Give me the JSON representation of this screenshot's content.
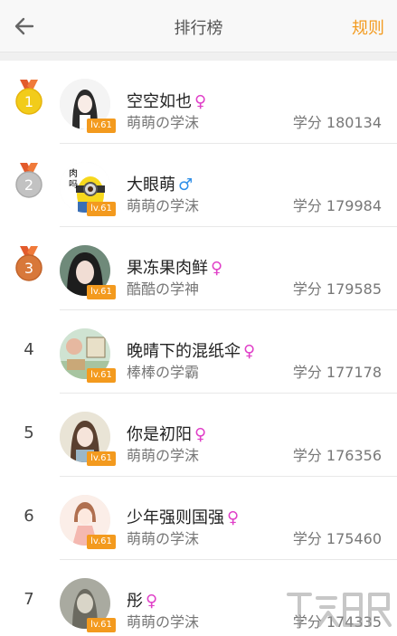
{
  "header": {
    "title": "排行榜",
    "rules_label": "规则"
  },
  "colors": {
    "accent": "#f39a1e",
    "gold": "#f2cc1a",
    "silver": "#c2c2c2",
    "bronze": "#d8783a",
    "female": "#e040c8",
    "male": "#2f8fe8"
  },
  "rows": [
    {
      "rank": "1",
      "name": "空空如也",
      "gender": "♀",
      "gender_type": "female",
      "level": "lv.61",
      "title": "萌萌の学沫",
      "score": "学分 180134"
    },
    {
      "rank": "2",
      "name": "大眼萌",
      "gender": "♂",
      "gender_type": "male",
      "level": "lv.61",
      "title": "萌萌の学沫",
      "score": "学分 179984"
    },
    {
      "rank": "3",
      "name": "果冻果肉鲜",
      "gender": "♀",
      "gender_type": "female",
      "level": "lv.61",
      "title": "酷酷の学神",
      "score": "学分 179585"
    },
    {
      "rank": "4",
      "name": "晚晴下的混纸伞",
      "gender": "♀",
      "gender_type": "female",
      "level": "lv.61",
      "title": "棒棒の学霸",
      "score": "学分 177178"
    },
    {
      "rank": "5",
      "name": "你是初阳",
      "gender": "♀",
      "gender_type": "female",
      "level": "lv.61",
      "title": "萌萌の学沫",
      "score": "学分 176356"
    },
    {
      "rank": "6",
      "name": "少年强则国强",
      "gender": "♀",
      "gender_type": "female",
      "level": "lv.61",
      "title": "萌萌の学沫",
      "score": "学分 175460"
    },
    {
      "rank": "7",
      "name": "彤",
      "gender": "♀",
      "gender_type": "female",
      "level": "lv.61",
      "title": "萌萌の学沫",
      "score": "学分 174335"
    }
  ]
}
